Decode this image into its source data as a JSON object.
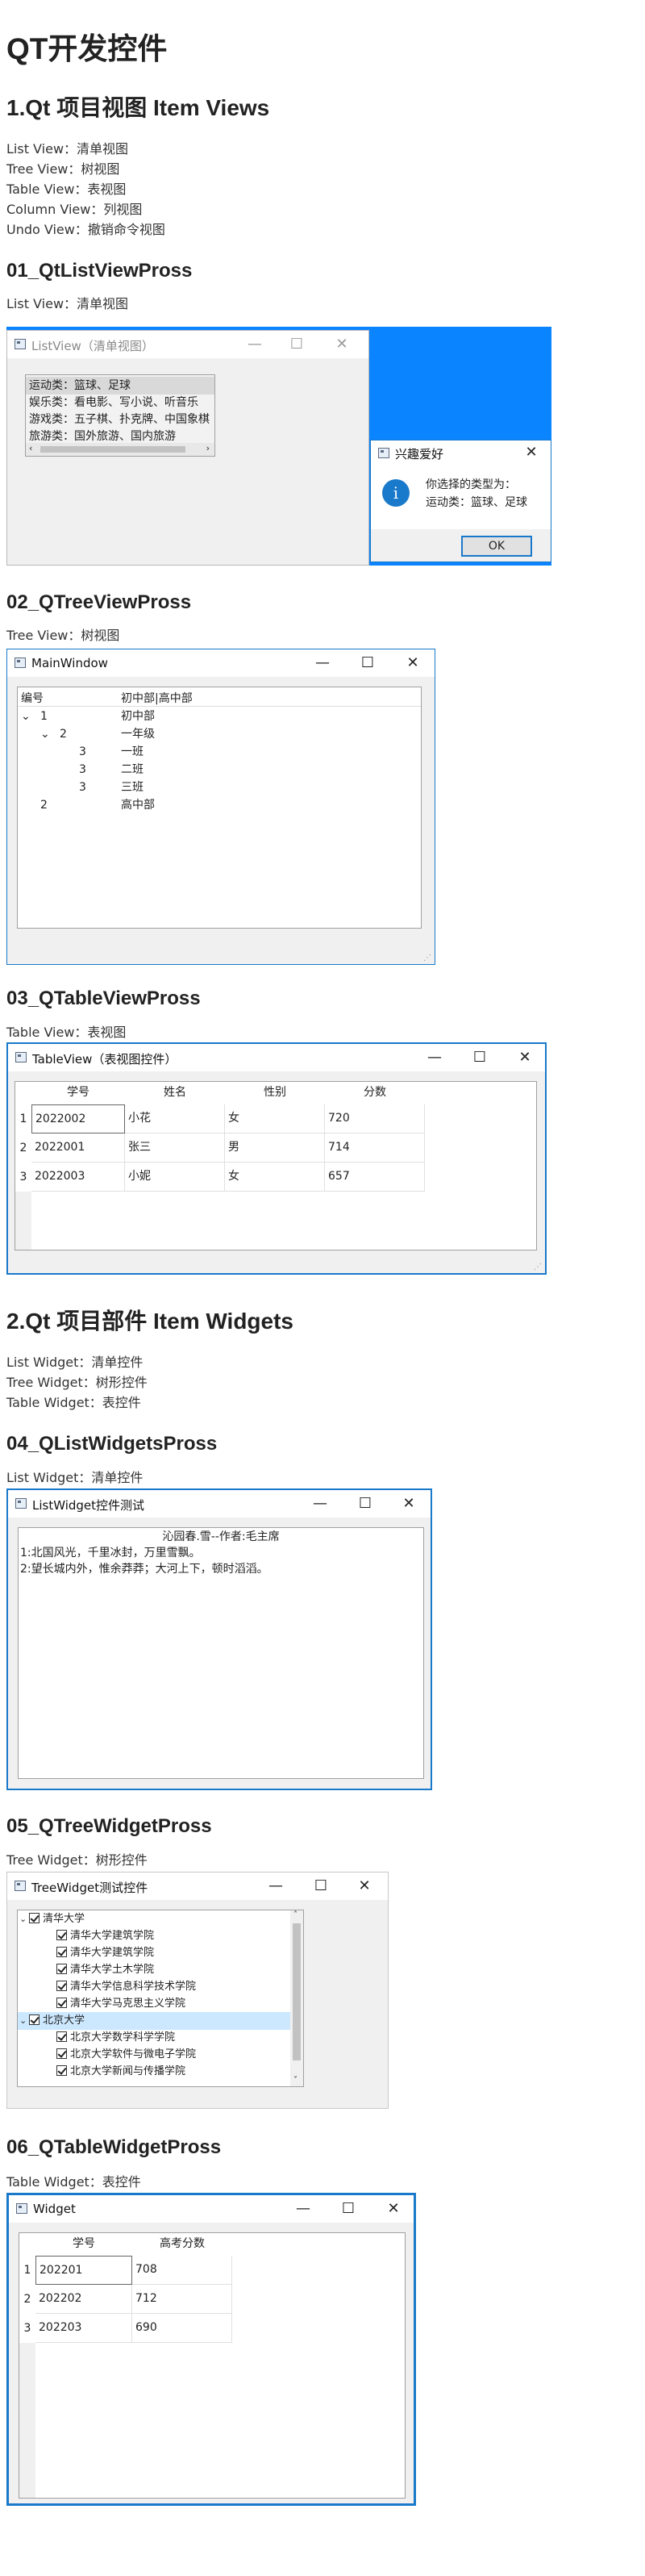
{
  "page_title": "QT开发控件",
  "section1": {
    "heading": "1.Qt 项目视图 Item Views",
    "lines": [
      "List View：清单视图",
      "Tree View：树视图",
      "Table View：表视图",
      "Column View：列视图",
      "Undo View：撤销命令视图"
    ]
  },
  "s01": {
    "heading": "01_QtListViewPross",
    "desc": "List View：清单视图",
    "window_title": "ListView（清单视图）",
    "items": [
      "运动类：篮球、足球",
      "娱乐类：看电影、写小说、听音乐",
      "游戏类：五子棋、扑克牌、中国象棋",
      "旅游类：国外旅游、国内旅游"
    ],
    "dialog_title": "兴趣爱好",
    "dialog_line1": "你选择的类型为：",
    "dialog_line2": "运动类：篮球、足球",
    "ok": "OK",
    "close": "✕",
    "min": "—",
    "max": "☐",
    "info_icon": "i"
  },
  "s02": {
    "heading": "02_QTreeViewPross",
    "desc": "Tree View：树视图",
    "window_title": "MainWindow",
    "col1": "编号",
    "col2": "初中部|高中部",
    "rows": [
      {
        "num": "1",
        "name": "初中部"
      },
      {
        "num": "2",
        "name": "一年级"
      },
      {
        "num": "3",
        "name": "一班"
      },
      {
        "num": "3",
        "name": "二班"
      },
      {
        "num": "3",
        "name": "三班"
      },
      {
        "num": "2",
        "name": "高中部"
      }
    ]
  },
  "s03": {
    "heading": "03_QTableViewPross",
    "desc": "Table View：表视图",
    "window_title": "TableView（表视图控件）",
    "headers": [
      "学号",
      "姓名",
      "性别",
      "分数"
    ],
    "rows": [
      {
        "n": "1",
        "id": "2022002",
        "name": "小花",
        "sex": "女",
        "score": "720"
      },
      {
        "n": "2",
        "id": "2022001",
        "name": "张三",
        "sex": "男",
        "score": "714"
      },
      {
        "n": "3",
        "id": "2022003",
        "name": "小妮",
        "sex": "女",
        "score": "657"
      }
    ]
  },
  "section2": {
    "heading": "2.Qt 项目部件 Item Widgets",
    "lines": [
      "List Widget：清单控件",
      "Tree Widget：树形控件",
      "Table Widget：表控件"
    ]
  },
  "s04": {
    "heading": "04_QListWidgetsPross",
    "desc": "List Widget：清单控件",
    "window_title": "ListWidget控件测试",
    "lines": [
      "沁园春.雪--作者:毛主席",
      "1:北国风光，千里冰封，万里雪飘。",
      "2:望长城内外，惟余莽莽；大河上下，顿时滔滔。"
    ]
  },
  "s05": {
    "heading": "05_QTreeWidgetPross",
    "desc": "Tree Widget：树形控件",
    "window_title": "TreeWidget测试控件",
    "root1": "清华大学",
    "children1": [
      "清华大学建筑学院",
      "清华大学建筑学院",
      "清华大学土木学院",
      "清华大学信息科学技术学院",
      "清华大学马克思主义学院"
    ],
    "root2": "北京大学",
    "children2": [
      "北京大学数学科学学院",
      "北京大学软件与微电子学院",
      "北京大学新闻与传播学院"
    ]
  },
  "s06": {
    "heading": "06_QTableWidgetPross",
    "desc": "Table Widget：表控件",
    "window_title": "Widget",
    "headers": [
      "学号",
      "高考分数"
    ],
    "rows": [
      {
        "n": "1",
        "id": "202201",
        "score": "708"
      },
      {
        "n": "2",
        "id": "202202",
        "score": "712"
      },
      {
        "n": "3",
        "id": "202203",
        "score": "690"
      }
    ]
  },
  "colors": {
    "accent": "#1979ca",
    "desktop": "#0a84ff",
    "selection": "#cce8ff"
  }
}
